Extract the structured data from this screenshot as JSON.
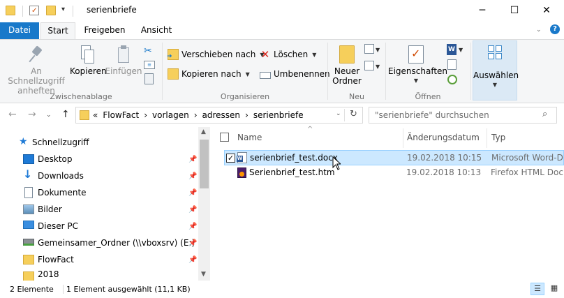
{
  "window": {
    "title": "serienbriefe",
    "min_glyph": "─",
    "max_glyph": "☐",
    "close_glyph": "✕"
  },
  "tabs": {
    "datei": "Datei",
    "start": "Start",
    "freigeben": "Freigeben",
    "ansicht": "Ansicht"
  },
  "ribbon": {
    "zwischenablage": {
      "label": "Zwischenablage",
      "pin_line1": "An Schnellzugriff",
      "pin_line2": "anheften",
      "copy": "Kopieren",
      "paste": "Einfügen"
    },
    "organisieren": {
      "label": "Organisieren",
      "move_to": "Verschieben nach",
      "copy_to": "Kopieren nach",
      "delete": "Löschen",
      "rename": "Umbenennen"
    },
    "neu": {
      "label": "Neu",
      "new_folder_line1": "Neuer",
      "new_folder_line2": "Ordner"
    },
    "oeffnen": {
      "label": "Öffnen",
      "properties": "Eigenschaften"
    },
    "auswaehlen": {
      "label": "Auswählen"
    }
  },
  "address": {
    "chevrons": "«",
    "crumbs": [
      "FlowFact",
      "vorlagen",
      "adressen",
      "serienbriefe"
    ],
    "sep": "›",
    "search_placeholder": "\"serienbriefe\" durchsuchen"
  },
  "nav": {
    "items": [
      {
        "label": "Schnellzugriff",
        "pinned": false
      },
      {
        "label": "Desktop",
        "pinned": true
      },
      {
        "label": "Downloads",
        "pinned": true
      },
      {
        "label": "Dokumente",
        "pinned": true
      },
      {
        "label": "Bilder",
        "pinned": true
      },
      {
        "label": "Dieser PC",
        "pinned": true
      },
      {
        "label": "Gemeinsamer_Ordner (\\\\vboxsrv) (E:)",
        "pinned": true
      },
      {
        "label": "FlowFact",
        "pinned": true
      },
      {
        "label": "2018",
        "pinned": false
      }
    ]
  },
  "columns": {
    "name": "Name",
    "date": "Änderungsdatum",
    "type": "Typ"
  },
  "files": [
    {
      "name": "serienbrief_test.docx",
      "date": "19.02.2018 10:15",
      "type": "Microsoft Word-D...",
      "selected": true
    },
    {
      "name": "Serienbrief_test.htm",
      "date": "19.02.2018 10:13",
      "type": "Firefox HTML Doc...",
      "selected": false
    }
  ],
  "status": {
    "count": "2 Elemente",
    "selection": "1 Element ausgewählt (11,1 KB)"
  },
  "colors": {
    "accent": "#1979ca",
    "selection": "#cce8ff",
    "folder": "#f6cf5b"
  }
}
